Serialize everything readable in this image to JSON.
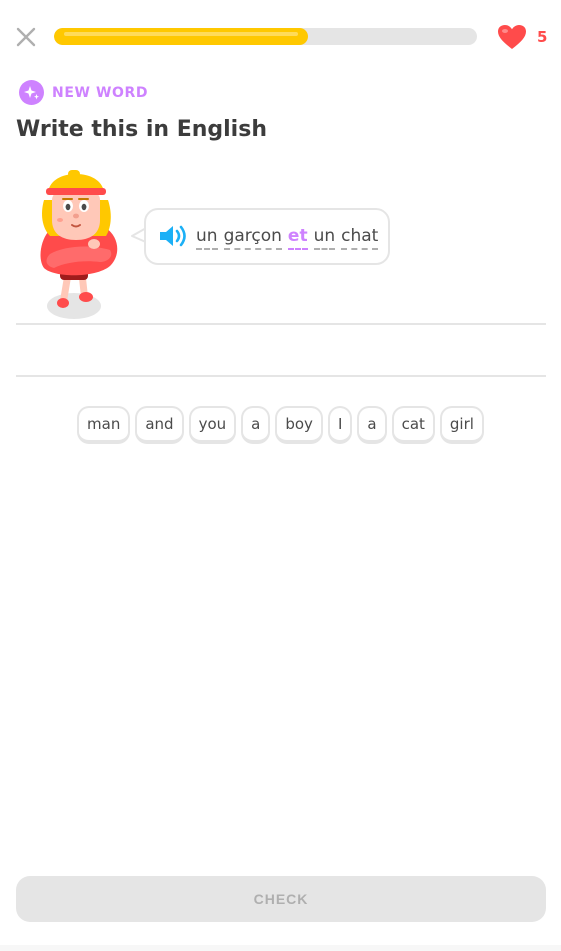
{
  "progress": {
    "fraction": 0.6,
    "color": "#ffc800"
  },
  "hearts": {
    "count": "5",
    "icon": "heart-icon",
    "color": "#ff4b4b"
  },
  "close": {
    "icon": "close-icon"
  },
  "header": {
    "badge_label": "NEW WORD",
    "badge_icon": "sparkle-icon",
    "badge_color": "#ce82ff",
    "title": "Write this in English"
  },
  "prompt": {
    "speaker_icon": "speaker-icon",
    "tokens": [
      {
        "text": "un",
        "new": false
      },
      {
        "text": "garçon",
        "new": false
      },
      {
        "text": "et",
        "new": true
      },
      {
        "text": "un",
        "new": false
      },
      {
        "text": "chat",
        "new": false
      }
    ]
  },
  "word_bank": [
    "man",
    "and",
    "you",
    "a",
    "boy",
    "I",
    "a",
    "cat",
    "girl"
  ],
  "footer": {
    "check_label": "CHECK"
  }
}
